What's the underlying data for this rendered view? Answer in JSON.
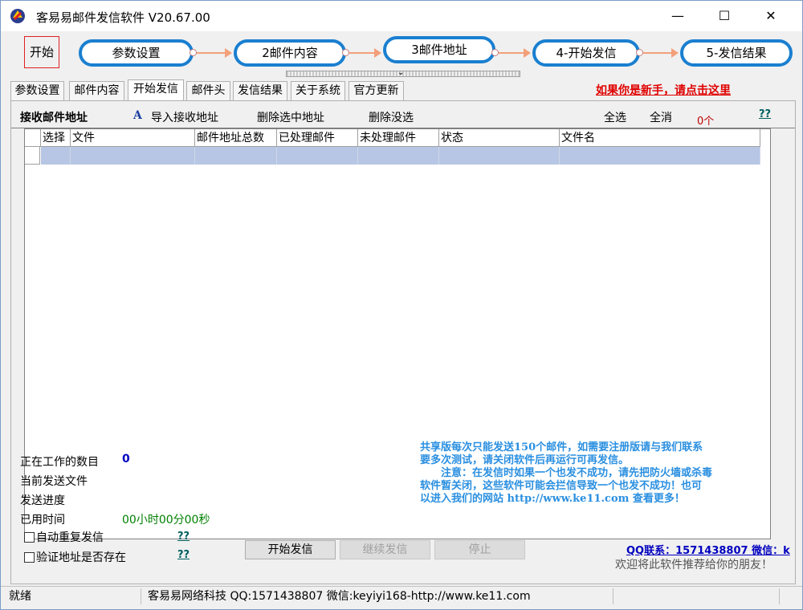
{
  "window": {
    "title": "客易易邮件发信软件 V20.67.00",
    "minimize": "—",
    "maximize": "☐",
    "close": "✕"
  },
  "workflow": {
    "start": "开始",
    "steps": [
      "参数设置",
      "2邮件内容",
      "3邮件地址",
      "4-开始发信",
      "5-发信结果"
    ]
  },
  "tabs": [
    "参数设置",
    "邮件内容",
    "开始发信",
    "邮件头",
    "发信结果",
    "关于系统",
    "官方更新"
  ],
  "active_tab": "开始发信",
  "help_link": "如果你是新手，请点击这里",
  "toolbar": {
    "title": "接收邮件地址",
    "import": "导入接收地址",
    "delete_selected": "删除选中地址",
    "delete_unselected": "删除没选",
    "select_all": "全选",
    "deselect_all": "全消",
    "count": "0个",
    "help": "??"
  },
  "grid": {
    "columns": [
      "选择",
      "文件",
      "邮件地址总数",
      "已处理邮件",
      "未处理邮件",
      "状态",
      "文件名"
    ]
  },
  "status": {
    "working_label": "正在工作的数目",
    "working_value": "0",
    "current_file_label": "当前发送文件",
    "progress_label": "发送进度",
    "elapsed_label": "已用时间",
    "elapsed_value": "00小时00分00秒"
  },
  "options": {
    "auto_repeat": "自动重复发信",
    "verify_address": "验证地址是否存在",
    "help": "??"
  },
  "notice": {
    "line1": "共享版每次只能发送150个邮件，如需要注册版请与我们联系",
    "line2": "要多次测试，请关闭软件后再运行可再发信。",
    "line3": "注意：在发信时如果一个也发不成功，请先把防火墙或杀毒",
    "line4": "软件暂关闭，这些软件可能会拦信导致一个也发不成功！也可",
    "line5": "以进入我们的网站 http://www.ke11.com 查看更多！"
  },
  "buttons": {
    "start": "开始发信",
    "continue": "继续发信",
    "stop": "停止"
  },
  "contact": {
    "qq": "QQ联系：1571438807 微信：k",
    "recommend": "欢迎将此软件推荐给你的朋友！"
  },
  "statusbar": {
    "state": "就绪",
    "company": "客易易网络科技 QQ:1571438807 微信:keyiyi168-http://www.ke11.com"
  }
}
